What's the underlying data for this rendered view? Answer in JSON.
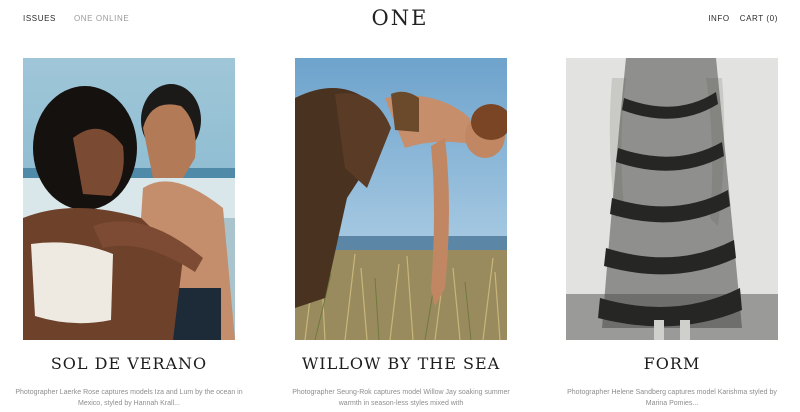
{
  "nav": {
    "issues": "ISSUES",
    "one_online": "ONE ONLINE",
    "info": "INFO",
    "cart": "CART (0)"
  },
  "brand": {
    "logo": "ONE"
  },
  "stories": [
    {
      "title": "SOL DE VERANO",
      "description": "Photographer Laerke Rose captures models Iza and Lum by the ocean in Mexico, styled by Hannah Krall..."
    },
    {
      "title": "WILLOW BY THE SEA",
      "description": "Photographer Seung-Rok captures model Willow Jay soaking summer warmth in season-less styles mixed with"
    },
    {
      "title": "FORM",
      "description": "Photographer Helene Sandberg captures model Karishma styled by Marina Pomies..."
    }
  ],
  "colors": {
    "text": "#2a2a2a",
    "muted": "#9a9a9a",
    "description": "#8e8e8e",
    "background": "#ffffff"
  }
}
